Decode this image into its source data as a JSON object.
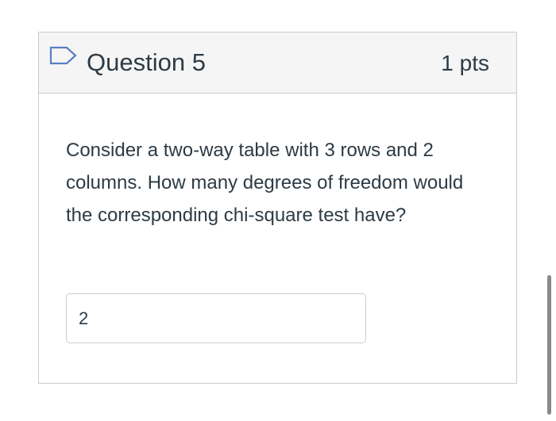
{
  "question": {
    "title": "Question 5",
    "points": "1 pts",
    "prompt": "Consider a two-way table with 3 rows and 2 columns. How many degrees of freedom would the corresponding chi-square test have?",
    "answer_value": "2",
    "flag_icon": "flag-outline-icon"
  },
  "colors": {
    "text": "#2d3b45",
    "border": "#c7cdd1",
    "header_bg": "#f5f5f5",
    "flag": "#5b7ec4"
  }
}
